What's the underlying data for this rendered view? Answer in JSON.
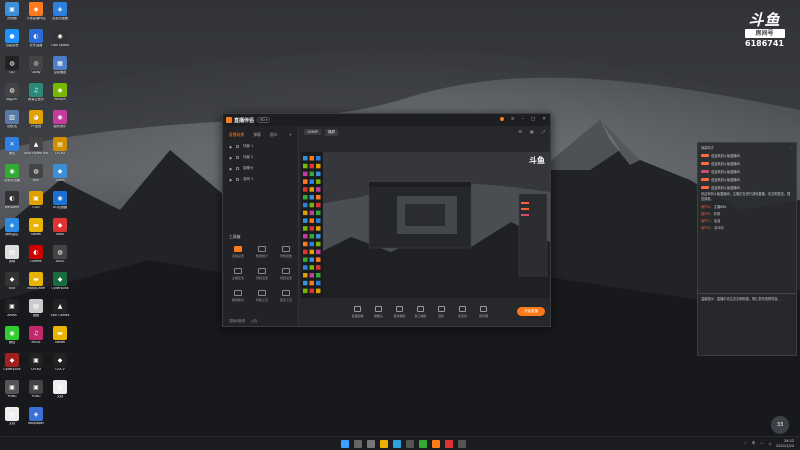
{
  "desktop": {
    "icons": [
      {
        "label": "此电脑",
        "color": "#3a8fd6",
        "glyph": "▣"
      },
      {
        "label": "斗鱼直播伴侣",
        "color": "#ff7a1a",
        "glyph": "◆"
      },
      {
        "label": "迅游加速器",
        "color": "#2d7fe0",
        "glyph": "◈"
      },
      {
        "label": "迅雷影音",
        "color": "#1e90ff",
        "glyph": "●"
      },
      {
        "label": "虎牙直播",
        "color": "#2a6bd8",
        "glyph": "◐"
      },
      {
        "label": "OBS Studio",
        "color": "#333",
        "glyph": "◉"
      },
      {
        "label": "QQ",
        "color": "#222",
        "glyph": "◍"
      },
      {
        "label": "Uplay",
        "color": "#444",
        "glyph": "◎"
      },
      {
        "label": "控制面板",
        "color": "#4c7fc5",
        "glyph": "▦"
      },
      {
        "label": "网易UU",
        "color": "#444",
        "glyph": "◍"
      },
      {
        "label": "网易云音乐",
        "color": "#2a8a7a",
        "glyph": "♫"
      },
      {
        "label": "NVIDIA",
        "color": "#76b900",
        "glyph": "◆"
      },
      {
        "label": "回收站",
        "color": "#5a7aa5",
        "glyph": "▥"
      },
      {
        "label": "YY语音",
        "color": "#e0a000",
        "glyph": "◕"
      },
      {
        "label": "酷狗音乐",
        "color": "#c43b9d",
        "glyph": "◉"
      },
      {
        "label": "微信",
        "color": "#2d7fe0",
        "glyph": "✕"
      },
      {
        "label": "AMD Ryzen Master",
        "color": "#444",
        "glyph": "▲"
      },
      {
        "label": "CPUID",
        "color": "#d08f00",
        "glyph": "▤"
      },
      {
        "label": "谷歌浏览器",
        "color": "#3a3",
        "glyph": "◉"
      },
      {
        "label": "HUE",
        "color": "#444",
        "glyph": "◍"
      },
      {
        "label": "Zoom",
        "color": "#3a8fd6",
        "glyph": "◆"
      },
      {
        "label": "WeGame",
        "color": "#333",
        "glyph": "◐"
      },
      {
        "label": "COD",
        "color": "#e0a000",
        "glyph": "▣"
      },
      {
        "label": "UU加速器",
        "color": "#1a72d6",
        "glyph": "◉"
      },
      {
        "label": "腾讯会议",
        "color": "#2a8ae0",
        "glyph": "◈"
      },
      {
        "label": "Steam",
        "color": "#e8b400",
        "glyph": "▬"
      },
      {
        "label": "Xbox",
        "color": "#d33",
        "glyph": "◆"
      },
      {
        "label": "剪映",
        "color": "#ddd",
        "glyph": "▤"
      },
      {
        "label": "Games",
        "color": "#c00",
        "glyph": "◐"
      },
      {
        "label": "ASUS",
        "color": "#444",
        "glyph": "◍"
      },
      {
        "label": "Epic",
        "color": "#333",
        "glyph": "◆"
      },
      {
        "label": "MusicDrive",
        "color": "#e8b400",
        "glyph": "▬"
      },
      {
        "label": "Cyberpunk",
        "color": "#1a6b3d",
        "glyph": "◆"
      },
      {
        "label": "ARMA",
        "color": "#222",
        "glyph": "▣"
      },
      {
        "label": "画图",
        "color": "#ccc",
        "glyph": "▤"
      },
      {
        "label": "Epic Games",
        "color": "#222",
        "glyph": "▲"
      },
      {
        "label": "微信",
        "color": "#3c3",
        "glyph": "◉"
      },
      {
        "label": "Music",
        "color": "#c2296b",
        "glyph": "♫"
      },
      {
        "label": "Steam",
        "color": "#e8b400",
        "glyph": "▬"
      },
      {
        "label": "Cyberpunk",
        "color": "#a1201f",
        "glyph": "◆"
      },
      {
        "label": "CPUID",
        "color": "#222",
        "glyph": "▣"
      },
      {
        "label": "GTA V",
        "color": "#222",
        "glyph": "◆"
      },
      {
        "label": "PUBG",
        "color": "#555",
        "glyph": "▣"
      },
      {
        "label": "PUBG",
        "color": "#444",
        "glyph": "▣"
      },
      {
        "label": "文档",
        "color": "#eee",
        "glyph": "▤"
      },
      {
        "label": "文档",
        "color": "#eee",
        "glyph": "▤"
      },
      {
        "label": "Wallpaper",
        "color": "#3a6fd6",
        "glyph": "◈"
      }
    ]
  },
  "douyu": {
    "room_label": "房间号",
    "room_number": "6186741"
  },
  "app": {
    "title": "直播伴侣",
    "hd": "HD ▾",
    "sidebar_tabs": [
      "直播场景",
      "弹幕",
      "观众",
      "+"
    ],
    "scenes": [
      "场景 1",
      "场景 2",
      "摄像头",
      "游戏 1"
    ],
    "tools_title": "工具箱",
    "tools": [
      "直播设置",
      "数据统计",
      "录像回放",
      "主播任务",
      "音频设置",
      "视频设置",
      "弹幕助手",
      "转播工具",
      "更多工具"
    ],
    "sidebar_footer": [
      "直播间管理",
      "公告"
    ],
    "preview_tabs": [
      "1080P",
      "横屏"
    ],
    "bottom_items": [
      "直播镜像",
      "摄像头",
      "游戏捕获",
      "窗口捕获",
      "图片",
      "麦克风",
      "扬声器"
    ],
    "start_label": "开始直播"
  },
  "chat": {
    "header": "弹幕助手",
    "lines": [
      "欢迎来到斗鱼直播间",
      "欢迎来到斗鱼直播间",
      "欢迎来到斗鱼直播间",
      "欢迎来到斗鱼直播间",
      "欢迎来到斗鱼直播间"
    ],
    "system_text": "欢迎来到斗鱼直播间，主播正在进行游戏直播，请文明发言，理性观看。",
    "users": [
      {
        "name": "用户A",
        "msg": "主播666"
      },
      {
        "name": "用户B",
        "msg": "好看"
      },
      {
        "name": "用户C",
        "msg": "加油"
      },
      {
        "name": "用户D",
        "msg": "冲冲冲"
      }
    ],
    "notice": "温馨提示：直播中请注意文明用语，禁止发布违规内容。"
  },
  "taskbar": {
    "icons": [
      {
        "name": "windows-icon",
        "color": "#3aa0ff"
      },
      {
        "name": "search-icon",
        "color": "#666"
      },
      {
        "name": "taskview-icon",
        "color": "#777"
      },
      {
        "name": "explorer-icon",
        "color": "#e8b400"
      },
      {
        "name": "edge-icon",
        "color": "#2fa3e0"
      },
      {
        "name": "store-icon",
        "color": "#555"
      },
      {
        "name": "chrome-icon",
        "color": "#3a3"
      },
      {
        "name": "app-icon",
        "color": "#ff7a1a"
      },
      {
        "name": "app2-icon",
        "color": "#d33"
      },
      {
        "name": "app3-icon",
        "color": "#555"
      }
    ],
    "time": "19:22",
    "date": "2022/1/24",
    "lang": "中",
    "weather": "33"
  }
}
